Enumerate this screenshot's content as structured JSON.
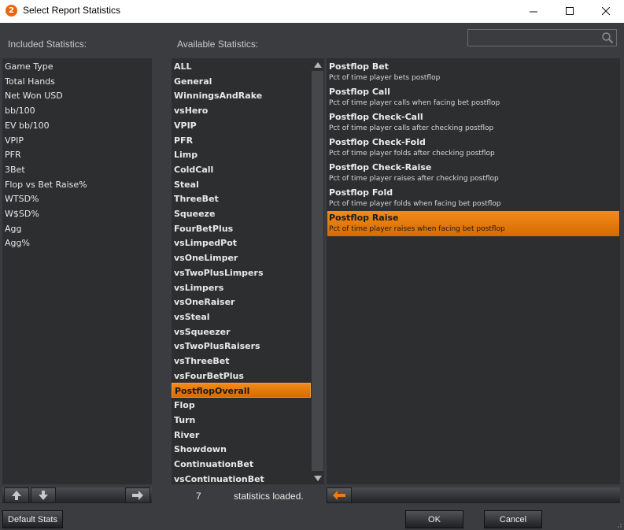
{
  "window": {
    "title": "Select Report Statistics",
    "app_icon_text": "2"
  },
  "headers": {
    "included": "Included Statistics:",
    "available": "Available Statistics:"
  },
  "search": {
    "value": "",
    "placeholder": ""
  },
  "included": [
    "Game Type",
    "Total Hands",
    "Net Won USD",
    "bb/100",
    "EV bb/100",
    "VPIP",
    "PFR",
    "3Bet",
    "Flop vs Bet Raise%",
    "WTSD%",
    "W$SD%",
    "Agg",
    "Agg%"
  ],
  "available": [
    "ALL",
    "General",
    "WinningsAndRake",
    "vsHero",
    "VPIP",
    "PFR",
    "Limp",
    "ColdCall",
    "Steal",
    "ThreeBet",
    "Squeeze",
    "FourBetPlus",
    "vsLimpedPot",
    "vsOneLimper",
    "vsTwoPlusLimpers",
    "vsLimpers",
    "vsOneRaiser",
    "vsSteal",
    "vsSqueezer",
    "vsTwoPlusRaisers",
    "vsThreeBet",
    "vsFourBetPlus",
    "PostflopOverall",
    "Flop",
    "Turn",
    "River",
    "Showdown",
    "ContinuationBet",
    "vsContinuationBet"
  ],
  "available_selected": "PostflopOverall",
  "stats": [
    {
      "name": "Postflop Bet",
      "desc": "Pct of time player bets postflop"
    },
    {
      "name": "Postflop Call",
      "desc": "Pct of time player calls when facing bet postflop"
    },
    {
      "name": "Postflop Check-Call",
      "desc": "Pct of time player calls after checking postflop"
    },
    {
      "name": "Postflop Check-Fold",
      "desc": "Pct of time player folds after checking postflop"
    },
    {
      "name": "Postflop Check-Raise",
      "desc": "Pct of time player raises after checking postflop"
    },
    {
      "name": "Postflop Fold",
      "desc": "Pct of time player folds when facing bet postflop"
    },
    {
      "name": "Postflop Raise",
      "desc": "Pct of time player raises when facing bet postflop"
    }
  ],
  "stats_selected": "Postflop Raise",
  "status": {
    "count": "7",
    "text": "statistics loaded."
  },
  "buttons": {
    "default_stats": "Default Stats",
    "ok": "OK",
    "cancel": "Cancel"
  },
  "colors": {
    "accent": "#e87a0c",
    "background": "#3a3c3f",
    "panel": "#2c2e30"
  },
  "icons": {
    "move_up": "arrow-up-icon",
    "move_down": "arrow-down-icon",
    "add": "arrow-right-icon",
    "remove": "arrow-left-icon",
    "search": "search-icon"
  }
}
